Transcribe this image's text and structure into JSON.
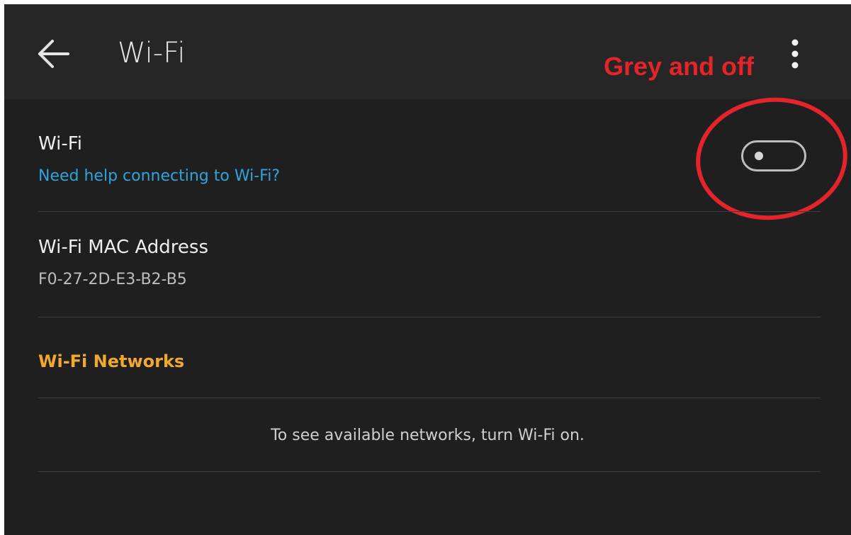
{
  "appbar": {
    "title": "Wi-Fi",
    "back_icon": "arrow-left-icon",
    "overflow_icon": "more-vert-icon"
  },
  "annotation": {
    "label": "Grey and off",
    "color": "#e3242b"
  },
  "wifi_row": {
    "title": "Wi-Fi",
    "help_link": "Need help connecting to Wi-Fi?",
    "toggle_state": "off"
  },
  "mac_row": {
    "title": "Wi-Fi MAC Address",
    "value": "F0-27-2D-E3-B2-B5"
  },
  "networks": {
    "header": "Wi-Fi Networks",
    "empty_message": "To see available networks, turn Wi-Fi on."
  },
  "colors": {
    "background": "#1f1f1f",
    "appbar": "#262626",
    "link": "#2fa4dc",
    "section_header": "#f0a830"
  }
}
